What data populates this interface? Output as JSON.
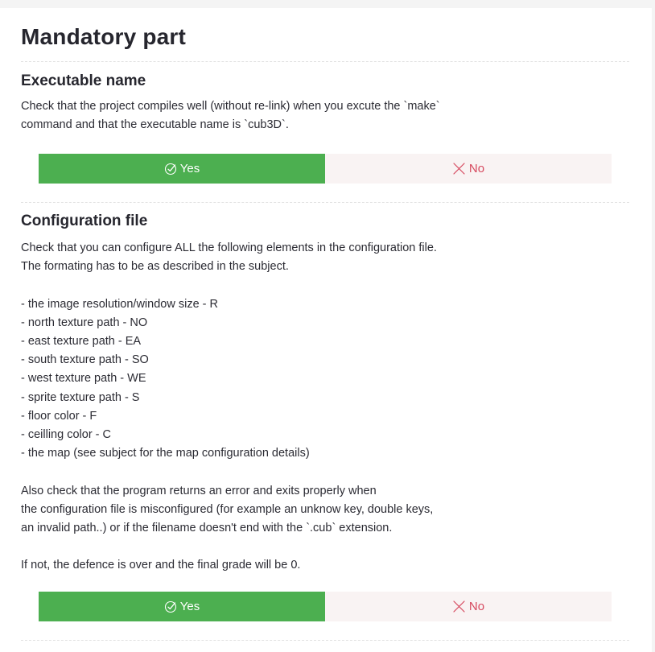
{
  "section": {
    "title": "Mandatory part"
  },
  "questions": [
    {
      "title": "Executable name",
      "lines": [
        "Check that the project compiles well (without re-link) when you excute the `make`",
        "command and that the executable name is `cub3D`."
      ],
      "yes_label": "Yes",
      "no_label": "No",
      "selected": "yes"
    },
    {
      "title": "Configuration file",
      "lines": [
        "Check that you can configure ALL the following elements in the configuration file.",
        "The formating has to be as described in the subject.",
        "",
        "- the image resolution/window size - R",
        "- north texture path - NO",
        "- east texture path - EA",
        "- south texture path - SO",
        "- west texture path - WE",
        "- sprite texture path - S",
        "- floor color - F",
        "- ceilling color - C",
        "- the map (see subject for the map configuration details)",
        "",
        "Also check that the program returns an error and exits properly when",
        "the configuration file is misconfigured (for example an unknow key, double keys,",
        "an invalid path..) or if the filename doesn't end with the `.cub` extension.",
        "",
        "If not, the defence is over and the final grade will be 0."
      ],
      "yes_label": "Yes",
      "no_label": "No",
      "selected": "yes"
    }
  ],
  "colors": {
    "yes_bg": "#4caf50",
    "no_bg": "#f9f3f3",
    "no_text": "#d6485e"
  },
  "icons": {
    "yes": "check-circle-icon",
    "no": "cross-icon"
  }
}
